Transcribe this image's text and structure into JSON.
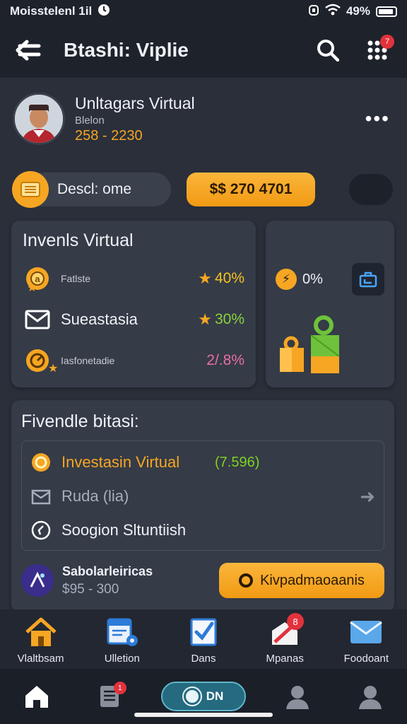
{
  "status_bar": {
    "left_text": "Moisstelenl 1il",
    "right_text": "49%"
  },
  "header": {
    "title": "Btashi: Viplie",
    "grid_badge": "7"
  },
  "profile": {
    "name": "Unltagars Virtual",
    "subtitle": "Blelon",
    "range": "258 - 2230"
  },
  "pills": {
    "desc_label": "Descl: ome",
    "amount_label": "$$ 270 4701"
  },
  "investments_card": {
    "title": "Invenls Virtual",
    "rows": [
      {
        "small": "Fatlste",
        "big": "",
        "value": "40%",
        "value_color": "#f6c21f"
      },
      {
        "small": "",
        "big": "Sueastasia",
        "value": "30%",
        "value_color": "#8ad43a"
      },
      {
        "small": "Iasfonetadie",
        "big": "",
        "value": "2/.8%",
        "value_color": "#e86fa3"
      }
    ]
  },
  "side_card": {
    "percent": "0%"
  },
  "favorites_card": {
    "title": "Fivendle bitasi:",
    "items": [
      {
        "label": "Investasin Virtual",
        "extra": "(7.596)"
      },
      {
        "label": "Ruda (lia)"
      },
      {
        "label": "Soogion Sltuntiish"
      }
    ]
  },
  "subscription": {
    "name": "Sabolarleiricas",
    "price": "$95 - 300",
    "button_label": "Kivpadmaoaanis"
  },
  "tabbar": {
    "tabs": [
      {
        "label": "Vlaltbsam"
      },
      {
        "label": "Ulletion"
      },
      {
        "label": "Dans"
      },
      {
        "label": "Mpanas",
        "badge": "8"
      },
      {
        "label": "Foodoant"
      }
    ]
  },
  "navbar": {
    "pill_label": "DN",
    "docs_badge": "1"
  }
}
